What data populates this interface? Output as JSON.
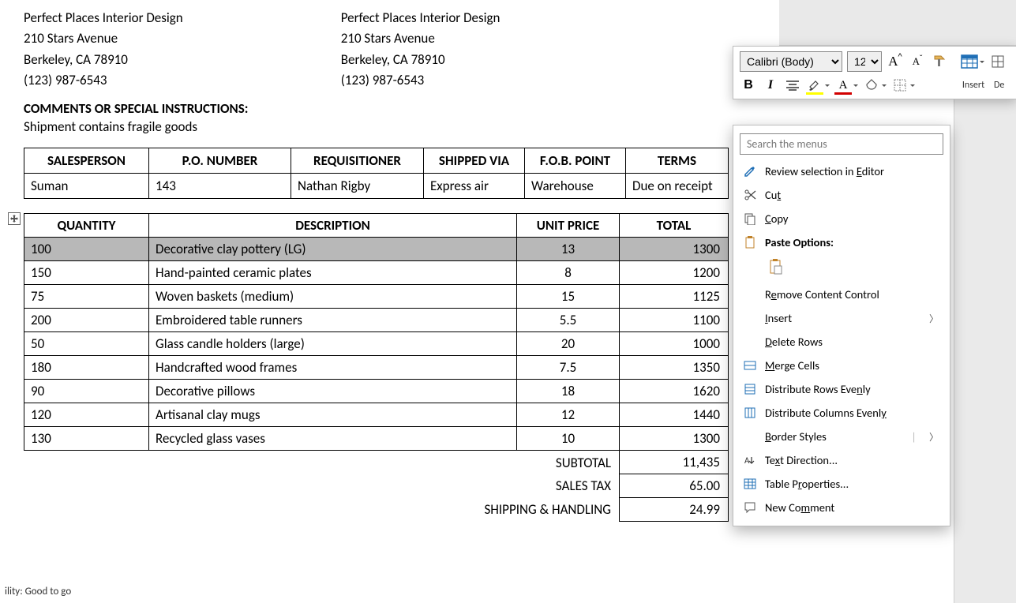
{
  "doc": {
    "address_left": {
      "l1": "Perfect Places Interior Design",
      "l2": "210 Stars Avenue",
      "l3": "Berkeley, CA 78910",
      "l4": "(123) 987-6543"
    },
    "address_right": {
      "l1": "Perfect Places Interior Design",
      "l2": "210 Stars Avenue",
      "l3": "Berkeley, CA 78910",
      "l4": "(123) 987-6543"
    },
    "comments_heading": "COMMENTS OR SPECIAL INSTRUCTIONS:",
    "comments_text": "Shipment contains fragile goods",
    "t1": {
      "headers": {
        "salesperson": "SALESPERSON",
        "po": "P.O. NUMBER",
        "requisitioner": "REQUISITIONER",
        "shipped": "SHIPPED VIA",
        "fob": "F.O.B. POINT",
        "terms": "TERMS"
      },
      "row": {
        "salesperson": "Suman",
        "po": "143",
        "requisitioner": "Nathan Rigby",
        "shipped": "Express air",
        "fob": "Warehouse",
        "terms": "Due on receipt"
      }
    },
    "t2": {
      "headers": {
        "qty": "QUANTITY",
        "desc": "DESCRIPTION",
        "unit": "UNIT PRICE",
        "total": "TOTAL"
      },
      "rows": [
        {
          "qty": "100",
          "desc": "Decorative clay pottery (LG)",
          "unit": "13",
          "total": "1300",
          "selected": true
        },
        {
          "qty": "150",
          "desc": "Hand-painted ceramic plates",
          "unit": "8",
          "total": "1200"
        },
        {
          "qty": "75",
          "desc": "Woven baskets (medium)",
          "unit": "15",
          "total": "1125"
        },
        {
          "qty": "200",
          "desc": "Embroidered table runners",
          "unit": "5.5",
          "total": "1100"
        },
        {
          "qty": "50",
          "desc": "Glass candle holders (large)",
          "unit": "20",
          "total": "1000"
        },
        {
          "qty": "180",
          "desc": "Handcrafted wood frames",
          "unit": "7.5",
          "total": "1350"
        },
        {
          "qty": "90",
          "desc": "Decorative pillows",
          "unit": "18",
          "total": "1620"
        },
        {
          "qty": "120",
          "desc": "Artisanal clay mugs",
          "unit": "12",
          "total": "1440"
        },
        {
          "qty": "130",
          "desc": "Recycled glass vases",
          "unit": "10",
          "total": "1300"
        }
      ],
      "summary": {
        "subtotal_label": "SUBTOTAL",
        "subtotal_value": "11,435",
        "tax_label": "SALES TAX",
        "tax_value": "65.00",
        "ship_label": "SHIPPING & HANDLING",
        "ship_value": "24.99"
      }
    }
  },
  "toolbar": {
    "font_name": "Calibri (Body)",
    "font_size": "12",
    "insert_label": "Insert",
    "delete_label": "De"
  },
  "context_menu": {
    "search_placeholder": "Search the menus",
    "review": "Review selection in Editor",
    "cut": "Cut",
    "copy": "Copy",
    "paste_options": "Paste Options:",
    "remove_cc": "Remove Content Control",
    "insert": "Insert",
    "delete_rows": "Delete Rows",
    "merge": "Merge Cells",
    "dist_rows": "Distribute Rows Evenly",
    "dist_cols": "Distribute Columns Evenly",
    "border_styles": "Border Styles",
    "text_direction": "Text Direction...",
    "table_properties": "Table Properties...",
    "new_comment": "New Comment"
  },
  "status_bar": {
    "text": "ility: Good to go"
  },
  "colors": {
    "highlight": "#ffff00",
    "font_color": "#d20000",
    "accent_blue": "#1f6fb6",
    "accent_orange": "#e07b28"
  }
}
